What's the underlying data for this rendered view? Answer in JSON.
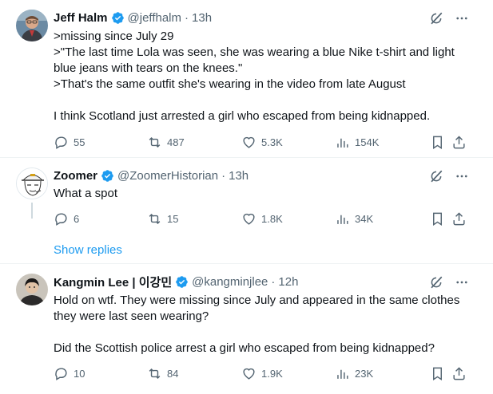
{
  "tweets": [
    {
      "name": "Jeff Halm",
      "handle": "@jeffhalm",
      "time": "13h",
      "lines": [
        ">missing since July 29",
        ">\"The last time Lola was seen, she was wearing a blue Nike t-shirt and light blue jeans with tears on the knees.\"",
        ">That's the same outfit she's wearing in the video from late August",
        "",
        "I think Scotland just arrested a girl who escaped from being kidnapped."
      ],
      "replies": "55",
      "retweets": "487",
      "likes": "5.3K",
      "views": "154K"
    },
    {
      "name": "Zoomer",
      "handle": "@ZoomerHistorian",
      "time": "13h",
      "lines": [
        "What a spot"
      ],
      "replies": "6",
      "retweets": "15",
      "likes": "1.8K",
      "views": "34K"
    },
    {
      "name": "Kangmin Lee | 이강민",
      "handle": "@kangminjlee",
      "time": "12h",
      "lines": [
        "Hold on wtf. They were missing since July and appeared in the same clothes they were last seen wearing?",
        "",
        "Did the Scottish police arrest a girl who escaped from being kidnapped?"
      ],
      "replies": "10",
      "retweets": "84",
      "likes": "1.9K",
      "views": "23K"
    }
  ],
  "show_replies_label": "Show replies",
  "separator": "·",
  "colors": {
    "accent": "#1d9bf0",
    "muted": "#536471",
    "text": "#0f1419",
    "divider": "#eff3f4"
  },
  "icons": [
    "verified-badge-icon",
    "grok-icon",
    "more-icon",
    "reply-icon",
    "retweet-icon",
    "like-icon",
    "views-icon",
    "bookmark-icon",
    "share-icon"
  ]
}
